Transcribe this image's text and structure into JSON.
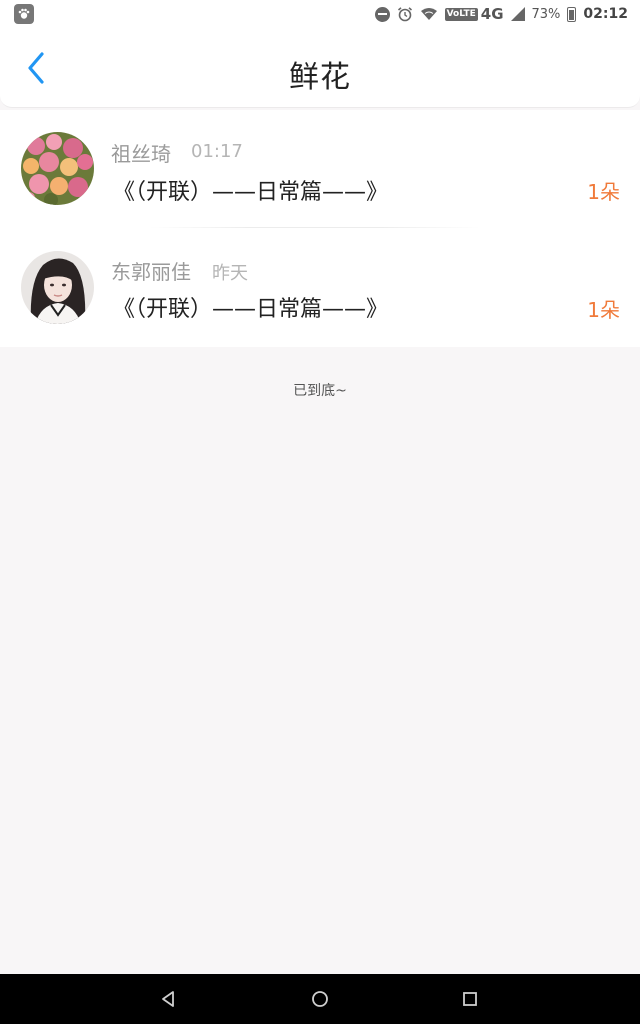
{
  "status_bar": {
    "battery_percent": "73%",
    "time": "02:12",
    "network": "4G",
    "volte": "VoLTE",
    "icons": [
      "app-badge-icon",
      "do-not-disturb-icon",
      "alarm-icon",
      "wifi-icon",
      "volte-icon",
      "signal-icon",
      "battery-icon"
    ]
  },
  "header": {
    "title": "鲜花",
    "back_icon": "chevron-left-icon",
    "accent_color": "#2196f3"
  },
  "flowers": [
    {
      "name": "祖丝琦",
      "time": "01:17",
      "title": "《（开联）——日常篇——》",
      "count": "1朵",
      "avatar": "flowers-photo"
    },
    {
      "name": "东郭丽佳",
      "time": "昨天",
      "title": "《（开联）——日常篇——》",
      "count": "1朵",
      "avatar": "girl-portrait-photo"
    }
  ],
  "end_text": "已到底~",
  "system_nav": {
    "icons": [
      "back-triangle-icon",
      "home-circle-icon",
      "recents-square-icon"
    ]
  },
  "colors": {
    "accent": "#2196f3",
    "count": "#f07a3a",
    "background": "#f8f6f7"
  }
}
